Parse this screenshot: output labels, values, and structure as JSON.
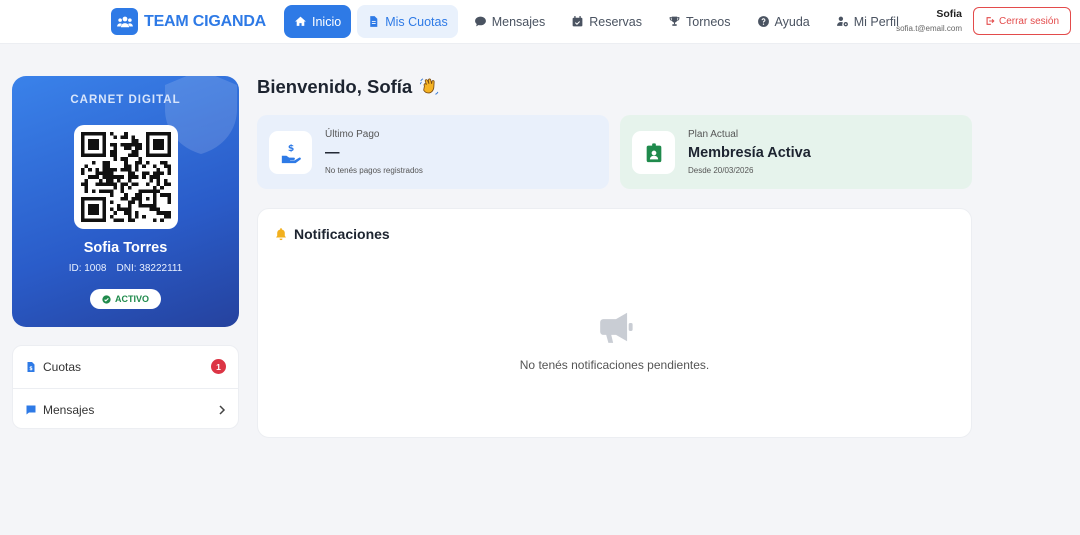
{
  "brand": {
    "name": "TEAM CIGANDA",
    "color": "#2e7ae6"
  },
  "nav": {
    "items": [
      {
        "label": "Inicio",
        "icon": "home-icon",
        "state": "active"
      },
      {
        "label": "Mis Cuotas",
        "icon": "file-invoice-icon",
        "state": "soft"
      },
      {
        "label": "Mensajes",
        "icon": "chat-icon",
        "state": ""
      },
      {
        "label": "Reservas",
        "icon": "calendar-check-icon",
        "state": ""
      },
      {
        "label": "Torneos",
        "icon": "trophy-icon",
        "state": ""
      },
      {
        "label": "Ayuda",
        "icon": "question-icon",
        "state": ""
      },
      {
        "label": "Mi Perfil",
        "icon": "user-gear-icon",
        "state": ""
      }
    ]
  },
  "user": {
    "name": "Sofia",
    "email": "sofia.t@email.com",
    "logout_label": "Cerrar sesión"
  },
  "carnet": {
    "title": "CARNET DIGITAL",
    "name": "Sofia Torres",
    "id_text": "ID: 1008",
    "dni_text": "DNI: 38222111",
    "status": "ACTIVO"
  },
  "side": {
    "cuotas_label": "Cuotas",
    "cuotas_count": "1",
    "mensajes_label": "Mensajes"
  },
  "main": {
    "welcome": "Bienvenido, Sofía",
    "last_payment": {
      "label": "Último Pago",
      "value": "—",
      "sub": "No tenés pagos registrados"
    },
    "plan": {
      "label": "Plan Actual",
      "value": "Membresía Activa",
      "sub": "Desde 20/03/2026"
    },
    "notifications": {
      "title": "Notificaciones",
      "empty_text": "No tenés notificaciones pendientes."
    }
  },
  "colors": {
    "primary": "#2e7ae6",
    "danger": "#dc3545",
    "success": "#1f8a4c"
  }
}
